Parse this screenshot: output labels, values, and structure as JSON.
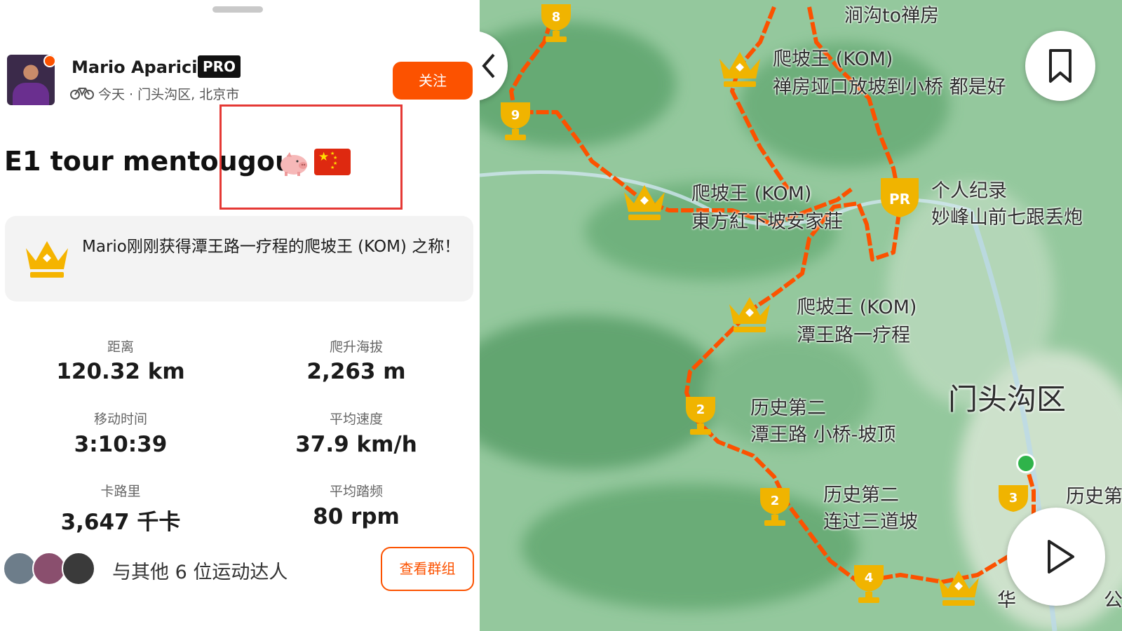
{
  "athlete": {
    "name": "Mario Aparicio",
    "badge": "PRO",
    "meta": "今天 · 门头沟区, 北京市",
    "follow_label": "关注"
  },
  "activity": {
    "title": "E1 tour mentougou",
    "emoji": [
      "pig-icon",
      "china-flag-icon"
    ]
  },
  "achievement": {
    "text": "Mario刚刚获得潭王路一疗程的爬坡王 (KOM) 之称！"
  },
  "stats": [
    {
      "label": "距离",
      "value": "120.32 km"
    },
    {
      "label": "爬升海拔",
      "value": "2,263 m"
    },
    {
      "label": "移动时间",
      "value": "3:10:39"
    },
    {
      "label": "平均速度",
      "value": "37.9 km/h"
    },
    {
      "label": "卡路里",
      "value": "3,647 千卡"
    },
    {
      "label": "平均踏频",
      "value": "80 rpm"
    }
  ],
  "group": {
    "text": "与其他 6 位运动达人",
    "button_label": "查看群组"
  },
  "map": {
    "district": "门头沟区",
    "labels": {
      "l1": "涧沟to禅房",
      "l2a": "爬坡王 (KOM)",
      "l2b": "禅房垭口放坡到小桥 都是好",
      "l3a": "爬坡王 (KOM)",
      "l3b": "東方紅下坡安家莊",
      "l4a": "个人纪录",
      "l4b": "妙峰山前七跟丢炮",
      "l5a": "爬坡王 (KOM)",
      "l5b": "潭王路一疗程",
      "l6a": "历史第二",
      "l6b": "潭王路 小桥-坡顶",
      "l7a": "历史第二",
      "l7b": "连过三道坡",
      "l8": "历史第",
      "l9": "华",
      "l10": "公"
    },
    "trophies": {
      "t8": "8",
      "t9": "9",
      "t2a": "2",
      "t2b": "2",
      "t4": "4",
      "t3": "3",
      "pr": "PR"
    },
    "colors": {
      "route": "#fc5200",
      "trophy": "#f0b400",
      "terrain": "#8fc59a"
    }
  }
}
